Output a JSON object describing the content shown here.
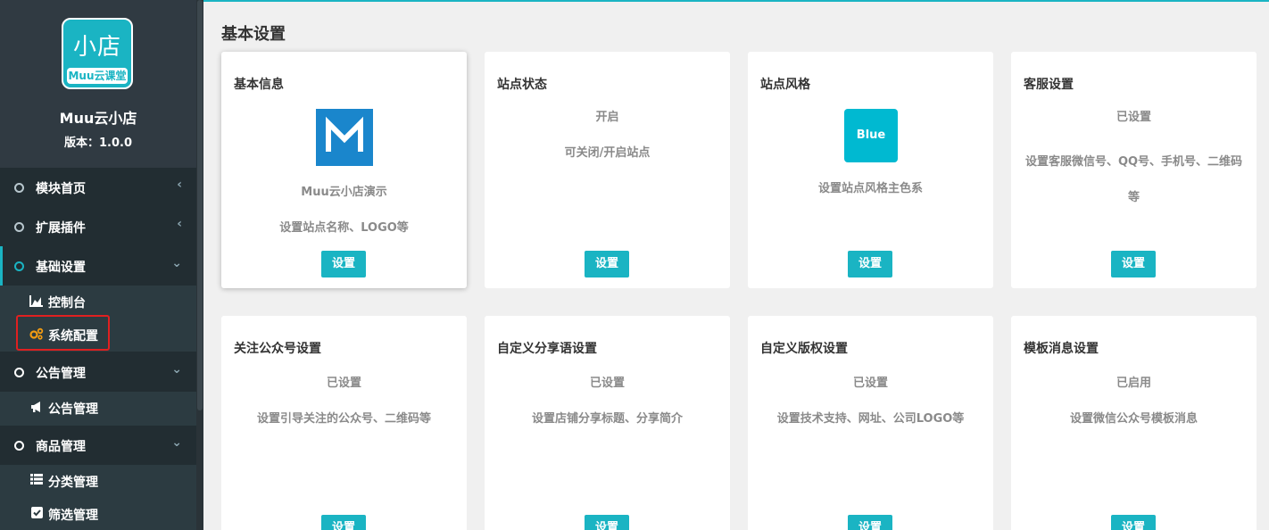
{
  "sidebar": {
    "logo": {
      "main": "小店",
      "sub": "Muu云课堂"
    },
    "app_name": "Muu云小店",
    "version": "版本：1.0.0",
    "items": [
      {
        "label": "模块首页"
      },
      {
        "label": "扩展插件"
      },
      {
        "label": "基础设置"
      },
      {
        "label": "公告管理"
      },
      {
        "label": "商品管理"
      }
    ],
    "sub_basic": [
      {
        "label": "控制台",
        "icon": "area-chart-icon"
      },
      {
        "label": "系统配置",
        "icon": "gears-icon"
      }
    ],
    "sub_notice": [
      {
        "label": "公告管理",
        "icon": "bullhorn-icon"
      }
    ],
    "sub_goods": [
      {
        "label": "分类管理",
        "icon": "list-icon"
      },
      {
        "label": "筛选管理",
        "icon": "check-square-icon"
      }
    ]
  },
  "main": {
    "title": "基本设置",
    "cards": [
      {
        "title": "基本信息",
        "line1": "Muu云小店演示",
        "line2": "设置站点名称、LOGO等",
        "button": "设置"
      },
      {
        "title": "站点状态",
        "line1": "开启",
        "line2": "可关闭/开启站点",
        "button": "设置"
      },
      {
        "title": "站点风格",
        "thumb": "Blue",
        "line1": "设置站点风格主色系",
        "button": "设置"
      },
      {
        "title": "客服设置",
        "line1": "已设置",
        "line2": "设置客服微信号、QQ号、手机号、二维码等",
        "button": "设置"
      },
      {
        "title": "关注公众号设置",
        "line1": "已设置",
        "line2": "设置引导关注的公众号、二维码等",
        "button": "设置"
      },
      {
        "title": "自定义分享语设置",
        "line1": "已设置",
        "line2": "设置店铺分享标题、分享简介",
        "button": "设置"
      },
      {
        "title": "自定义版权设置",
        "line1": "已设置",
        "line2": "设置技术支持、网址、公司LOGO等",
        "button": "设置"
      },
      {
        "title": "模板消息设置",
        "line1": "已启用",
        "line2": "设置微信公众号模板消息",
        "button": "设置"
      }
    ]
  },
  "colors": {
    "accent": "#1ab4c3",
    "sidebar": "#222d32",
    "highlight": "#e02020"
  }
}
